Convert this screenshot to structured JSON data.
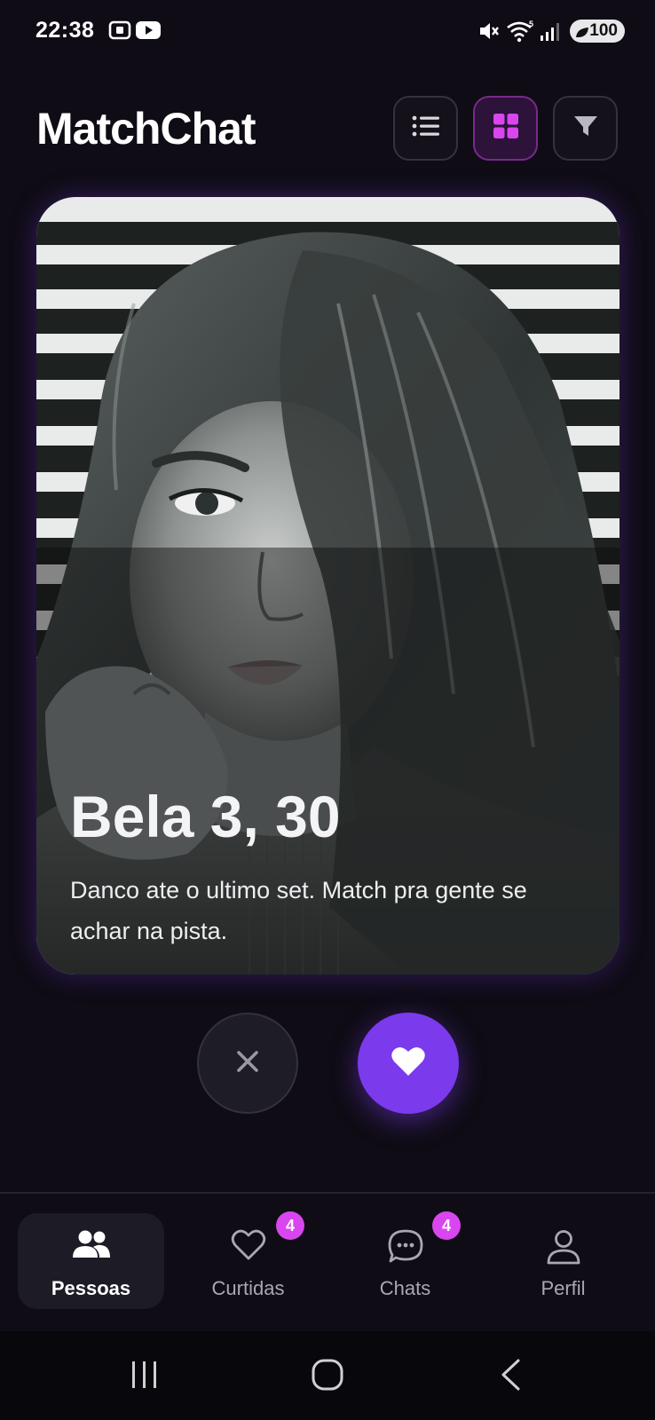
{
  "status_bar": {
    "time": "22:38",
    "battery": "100"
  },
  "header": {
    "title": "MatchChat",
    "view_buttons": [
      {
        "icon": "list-icon",
        "active": false
      },
      {
        "icon": "grid-icon",
        "active": true
      },
      {
        "icon": "filter-icon",
        "active": false
      }
    ]
  },
  "card": {
    "name": "Bela 3, 30",
    "bio": "Danco ate o ultimo set. Match pra gente se achar na pista."
  },
  "actions": {
    "dislike_icon": "close-icon",
    "like_icon": "heart-icon"
  },
  "bottom_nav": {
    "items": [
      {
        "label": "Pessoas",
        "icon": "people-icon",
        "active": true
      },
      {
        "label": "Curtidas",
        "icon": "heart-outline-icon",
        "active": false,
        "badge": "4"
      },
      {
        "label": "Chats",
        "icon": "chat-bubble-icon",
        "active": false,
        "badge": "4"
      },
      {
        "label": "Perfil",
        "icon": "person-icon",
        "active": false
      }
    ]
  },
  "colors": {
    "background": "#0f0c15",
    "accent": "#7c3aed",
    "badge": "#d946ef",
    "active_view": "#2d1239"
  }
}
